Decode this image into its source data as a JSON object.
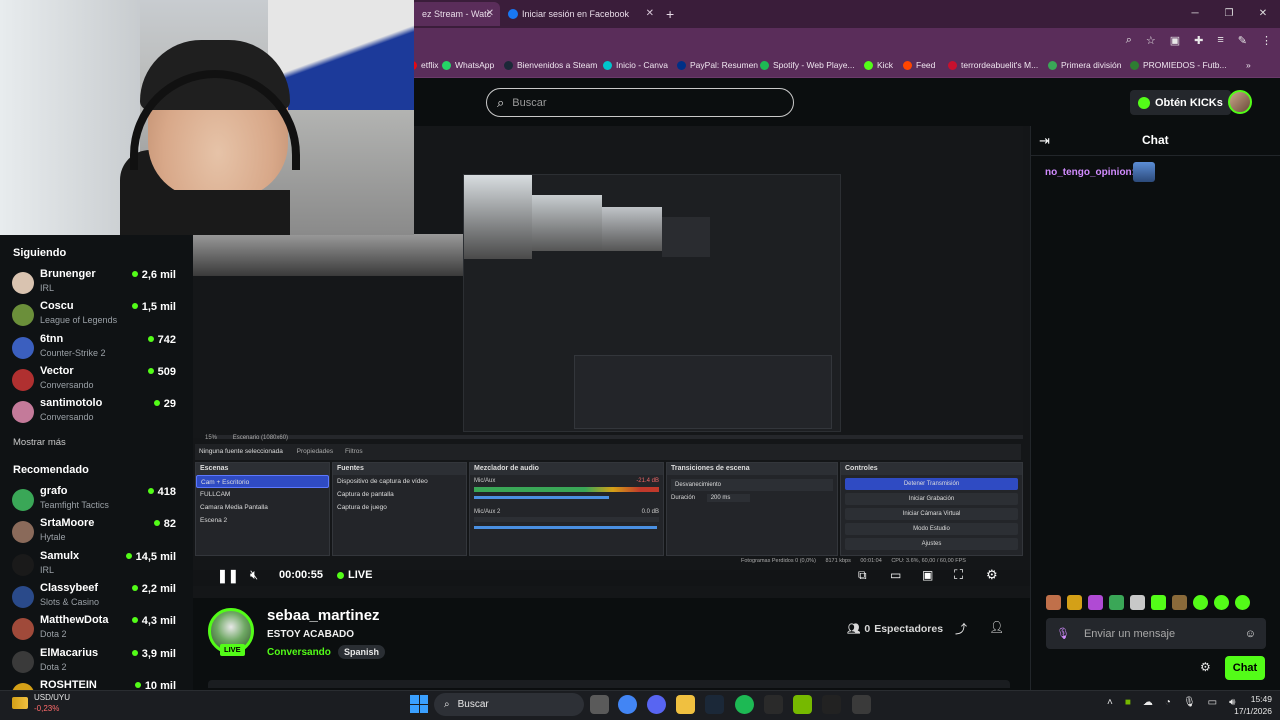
{
  "browser": {
    "tabs": [
      {
        "label": "ez Stream - Watc"
      },
      {
        "label": "Iniciar sesión en Facebook"
      }
    ],
    "new_tab": "+",
    "bookmarks": [
      "etflix",
      "WhatsApp",
      "Bienvenidos a Steam",
      "Inicio - Canva",
      "PayPal: Resumen",
      "Spotify - Web Playe...",
      "Kick",
      "Feed",
      "terrordeabuelit's M...",
      "Primera división",
      "PROMIEDOS - Futb..."
    ],
    "bookmark_colors": [
      "#e50914",
      "#25d366",
      "#1b2838",
      "#00c4cc",
      "#003087",
      "#1db954",
      "#53fc18",
      "#ff4500",
      "#c8102e",
      "#3aa757",
      "#2e7d32"
    ]
  },
  "header": {
    "search_placeholder": "Buscar",
    "get_kicks": "Obtén KICKs"
  },
  "sidebar": {
    "following_title": "Siguiendo",
    "following": [
      {
        "name": "Brunenger",
        "category": "IRL",
        "viewers": "2,6 mil",
        "color": "#d9c3b0"
      },
      {
        "name": "Coscu",
        "category": "League of Legends",
        "viewers": "1,5 mil",
        "color": "#6b8f3a"
      },
      {
        "name": "6tnn",
        "category": "Counter-Strike 2",
        "viewers": "742",
        "color": "#3b5fbf"
      },
      {
        "name": "Vector",
        "category": "Conversando",
        "viewers": "509",
        "color": "#b03030"
      },
      {
        "name": "santimotolo",
        "category": "Conversando",
        "viewers": "29",
        "color": "#c47a9a"
      }
    ],
    "show_more": "Mostrar más",
    "recommended_title": "Recomendado",
    "recommended": [
      {
        "name": "grafo",
        "category": "Teamfight Tactics",
        "viewers": "418",
        "color": "#3aa757"
      },
      {
        "name": "SrtaMoore",
        "category": "Hytale",
        "viewers": "82",
        "color": "#8a6a5a"
      },
      {
        "name": "Samulx",
        "category": "IRL",
        "viewers": "14,5 mil",
        "color": "#1a1a1a"
      },
      {
        "name": "Classybeef",
        "category": "Slots & Casino",
        "viewers": "2,2 mil",
        "color": "#2a4a8a"
      },
      {
        "name": "MatthewDota",
        "category": "Dota 2",
        "viewers": "4,3 mil",
        "color": "#a04a3a"
      },
      {
        "name": "ElMacarius",
        "category": "Dota 2",
        "viewers": "3,9 mil",
        "color": "#3a3a3a"
      },
      {
        "name": "ROSHTEIN",
        "category": "",
        "viewers": "10 mil",
        "color": "#d4a017"
      }
    ]
  },
  "obs": {
    "no_source": "Ninguna fuente seleccionada",
    "properties": "Propiedades",
    "filters": "Filtros",
    "scenes_title": "Escenas",
    "scenes": [
      "Cam + Escritorio",
      "FULLCAM",
      "Camara Media Pantalla",
      "Escena 2"
    ],
    "sources_title": "Fuentes",
    "sources": [
      "Dispositivo de captura de vídeo",
      "Captura de pantalla",
      "Captura de juego"
    ],
    "mixer_title": "Mezclador de audio",
    "mixer_channels": [
      {
        "name": "Mic/Aux",
        "db": "-21.4 dB"
      },
      {
        "name": "Mic/Aux 2",
        "db": "0.0 dB"
      }
    ],
    "transitions_title": "Transiciones de escena",
    "transition": "Desvanecimiento",
    "duration_label": "Duración",
    "duration_value": "200 ms",
    "controls_title": "Controles",
    "controls": [
      "Detener Transmisión",
      "Iniciar Grabación",
      "Iniciar Cámara Virtual",
      "Modo Estudio",
      "Ajustes"
    ],
    "status": "Fotogramas Perdidos 0 (0,0%)",
    "kbps": "8171 kbps",
    "time": "00:01:04",
    "cpu": "CPU: 3.6%, 60,00 / 60,00 FPS",
    "zoom": "15%",
    "scene_res": "Escenario (1080x60)"
  },
  "player": {
    "time": "00:00:55",
    "live": "LIVE"
  },
  "stream_info": {
    "channel": "sebaa_martinez",
    "title": "ESTOY ACABADO",
    "category": "Conversando",
    "language": "Spanish",
    "live_badge": "LIVE",
    "viewers_count": "0",
    "viewers_label": "Espectadores"
  },
  "chat": {
    "title": "Chat",
    "messages": [
      {
        "user": "no_tengo_opinion:"
      }
    ],
    "input_placeholder": "Enviar un mensaje",
    "send_label": "Chat"
  },
  "taskbar": {
    "search": "Buscar",
    "currency": "USD/UYU",
    "change": "-0,23%",
    "time": "15:49",
    "date": "17/1/2026"
  }
}
